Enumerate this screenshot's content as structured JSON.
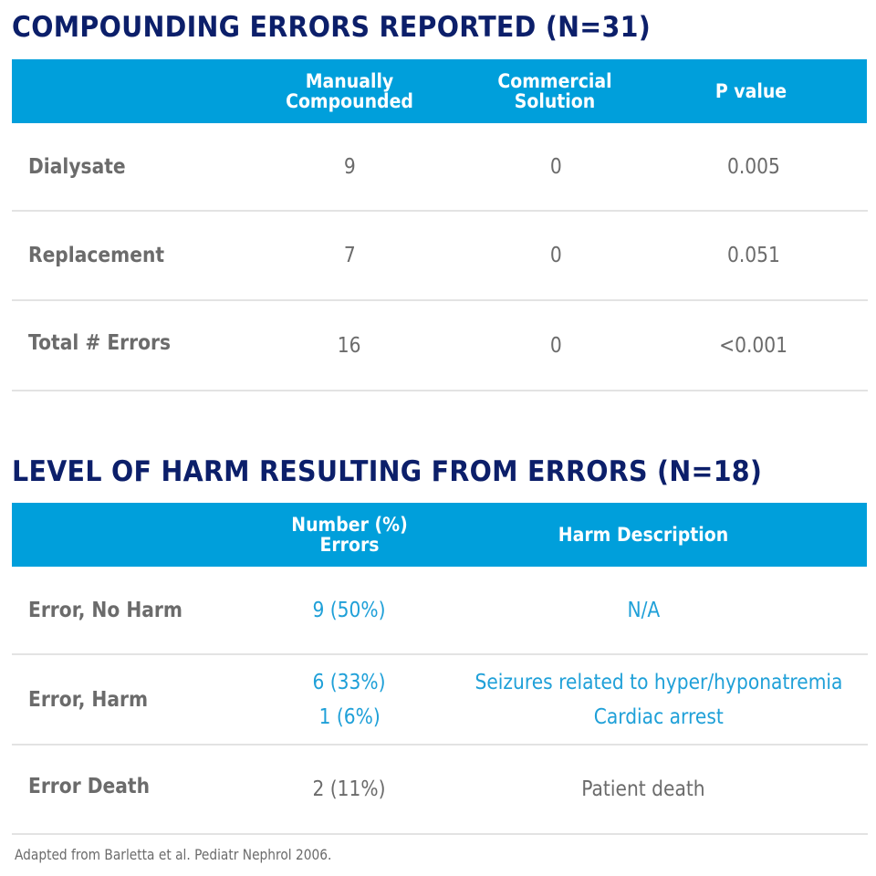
{
  "table1": {
    "title": "COMPOUNDING ERRORS REPORTED (N=31)",
    "headers": {
      "manual_line1": "Manually",
      "manual_line2": "Compounded",
      "commercial_line1": "Commercial",
      "commercial_line2": "Solution",
      "pvalue": "P value"
    },
    "rows": [
      {
        "label": "Dialysate",
        "manual": "9",
        "commercial": "0",
        "pvalue": "0.005"
      },
      {
        "label": "Replacement",
        "manual": "7",
        "commercial": "0",
        "pvalue": "0.051"
      },
      {
        "label": "Total # Errors",
        "manual": "16",
        "commercial": "0",
        "pvalue": "<0.001"
      }
    ]
  },
  "table2": {
    "title": "LEVEL OF HARM RESULTING FROM ERRORS (N=18)",
    "headers": {
      "number_line1": "Number (%)",
      "number_line2": "Errors",
      "description": "Harm Description"
    },
    "rows": [
      {
        "label": "Error, No Harm",
        "numbers": [
          "9 (50%)"
        ],
        "descriptions": [
          "N/A"
        ]
      },
      {
        "label": "Error, Harm",
        "numbers": [
          "6 (33%)",
          "1 (6%)"
        ],
        "descriptions": [
          "Seizures related to hyper/hyponatremia",
          "Cardiac arrest"
        ]
      },
      {
        "label": "Error Death",
        "numbers": [
          "2 (11%)"
        ],
        "descriptions": [
          "Patient death"
        ]
      }
    ]
  },
  "footnote": "Adapted from Barletta et al. Pediatr Nephrol 2006.",
  "colors": {
    "title": "#0c1f6a",
    "header_bg": "#009fdb",
    "body_text": "#6b6b6b",
    "accent_text": "#1fa0d8",
    "divider": "#e3e3e3"
  }
}
